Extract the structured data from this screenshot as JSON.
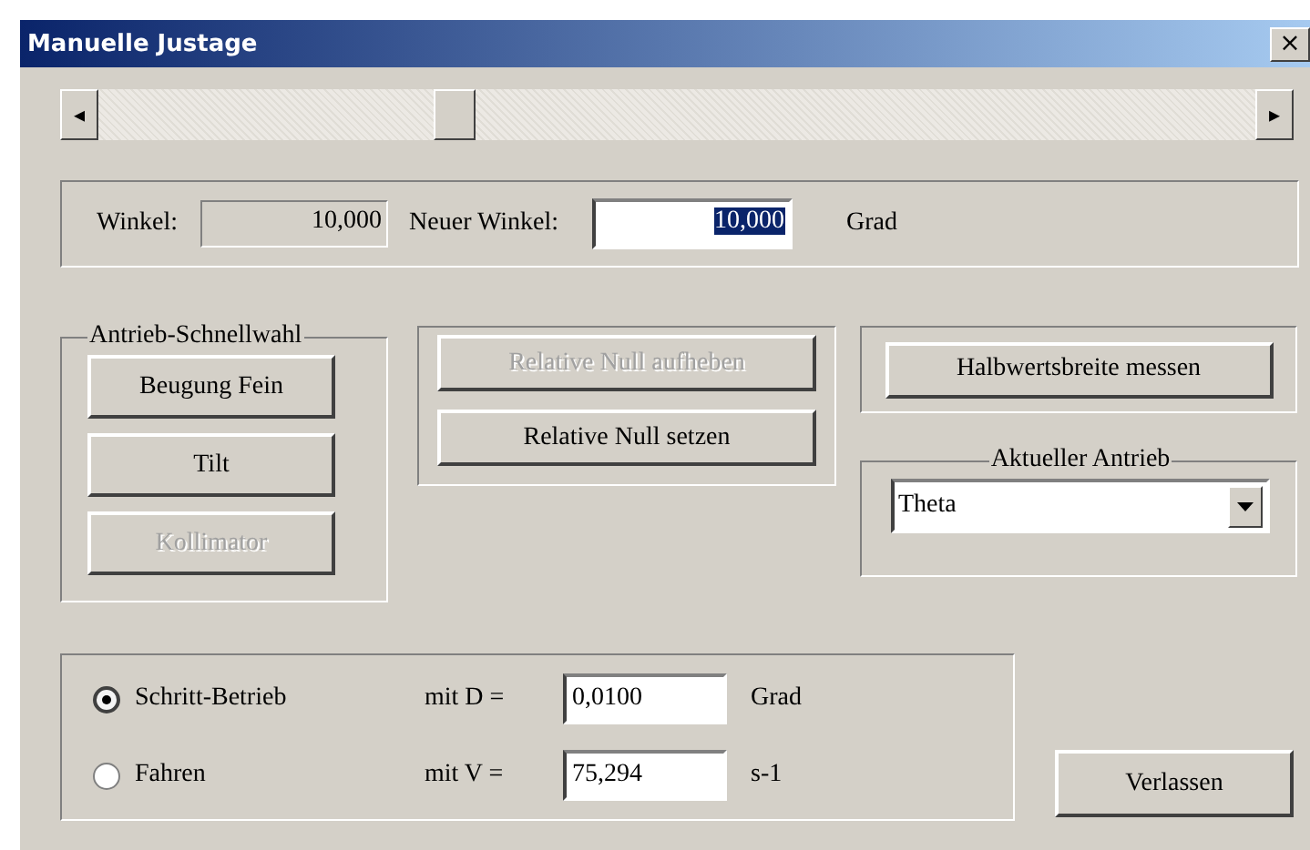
{
  "window": {
    "title": "Manuelle Justage",
    "close_label": "×"
  },
  "slider": {
    "level": 0.29,
    "left_arrow": "◂",
    "right_arrow": "▸"
  },
  "angle": {
    "label": "Winkel:",
    "value": "10,000",
    "new_label": "Neuer Winkel:",
    "new_value": "10,000",
    "unit": "Grad"
  },
  "quick_select": {
    "title": "Antrieb-Schnellwahl",
    "buttons": [
      {
        "label": "Beugung Fein",
        "disabled": false
      },
      {
        "label": "Tilt",
        "disabled": false
      },
      {
        "label": "Kollimator",
        "disabled": true
      }
    ]
  },
  "relative_null": {
    "buttons": [
      {
        "label": "Relative Null aufheben",
        "disabled": true
      },
      {
        "label": "Relative Null setzen",
        "disabled": false
      }
    ]
  },
  "fwhm_button": {
    "label": "Halbwertsbreite messen",
    "disabled": false
  },
  "current_drive": {
    "title": "Aktueller Antrieb",
    "value": "Theta"
  },
  "modes": [
    {
      "label": "Schritt-Betrieb",
      "selected": true,
      "param": "mit D =",
      "value": "0,0100",
      "unit": "Grad"
    },
    {
      "label": "Fahren",
      "selected": false,
      "param": "mit V =",
      "value": "75,294",
      "unit": "s-1"
    }
  ],
  "exit_button": {
    "label": "Verlassen",
    "disabled": false
  }
}
